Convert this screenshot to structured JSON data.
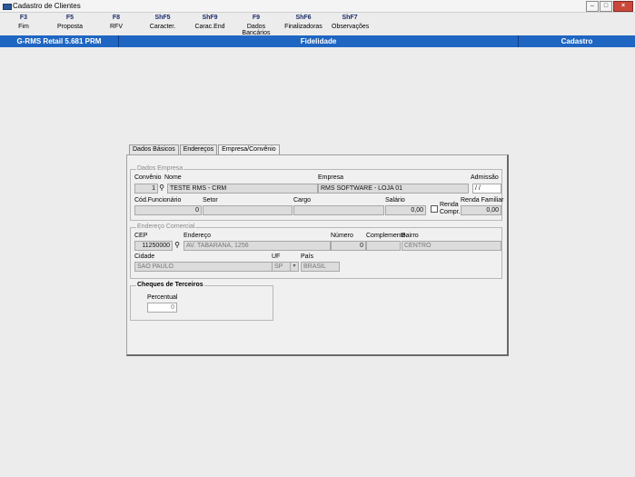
{
  "window": {
    "title": "Cadastro de Clientes"
  },
  "fkeys": [
    {
      "key": "F3",
      "label": "Fim"
    },
    {
      "key": "F5",
      "label": "Proposta"
    },
    {
      "key": "F8",
      "label": "RFV"
    },
    {
      "key": "ShF5",
      "label": "Caracter."
    },
    {
      "key": "ShF9",
      "label": "Carac.End"
    },
    {
      "key": "F9",
      "label": "Dados Bancários"
    },
    {
      "key": "ShF6",
      "label": "Finalizadoras"
    },
    {
      "key": "ShF7",
      "label": "Observações"
    }
  ],
  "statusbar": {
    "app": "G-RMS Retail 5.681 PRM",
    "module": "Fidelidade",
    "mode": "Cadastro"
  },
  "tabs": [
    "Dados Básicos",
    "Endereços",
    "Empresa/Convênio"
  ],
  "dados_empresa": {
    "title": "Dados Empresa",
    "convenio_label": "Convênio",
    "convenio_value": "1",
    "nome_label": "Nome",
    "nome_value": "TESTE RMS - CRM",
    "empresa_label": "Empresa",
    "empresa_value": "RMS SOFTWARE - LOJA 01",
    "admissao_label": "Admissão",
    "admissao_value": " / /",
    "cod_func_label": "Cód.Funcionário",
    "cod_func_value": "0",
    "setor_label": "Setor",
    "setor_value": "",
    "cargo_label": "Cargo",
    "cargo_value": "",
    "salario_label": "Salário",
    "salario_value": "0,00",
    "renda_compr_label1": "Renda",
    "renda_compr_label2": "Compr.",
    "renda_familiar_label": "Renda Familiar",
    "renda_familiar_value": "0,00"
  },
  "endereco_comercial": {
    "title": "Endereço Comercial",
    "cep_label": "CEP",
    "cep_value": "11250000",
    "endereco_label": "Endereço",
    "endereco_value": "AV. TABARANA, 1256",
    "numero_label": "Número",
    "numero_value": "0",
    "complemento_label": "Complemento",
    "complemento_value": "",
    "bairro_label": "Bairro",
    "bairro_value": "CENTRO",
    "cidade_label": "Cidade",
    "cidade_value": "SAO PAULO",
    "uf_label": "UF",
    "uf_value": "SP",
    "pais_label": "País",
    "pais_value": "BRASIL"
  },
  "cheques": {
    "title": "Cheques de Terceiros",
    "percentual_label": "Percentual",
    "percentual_value": "0"
  }
}
